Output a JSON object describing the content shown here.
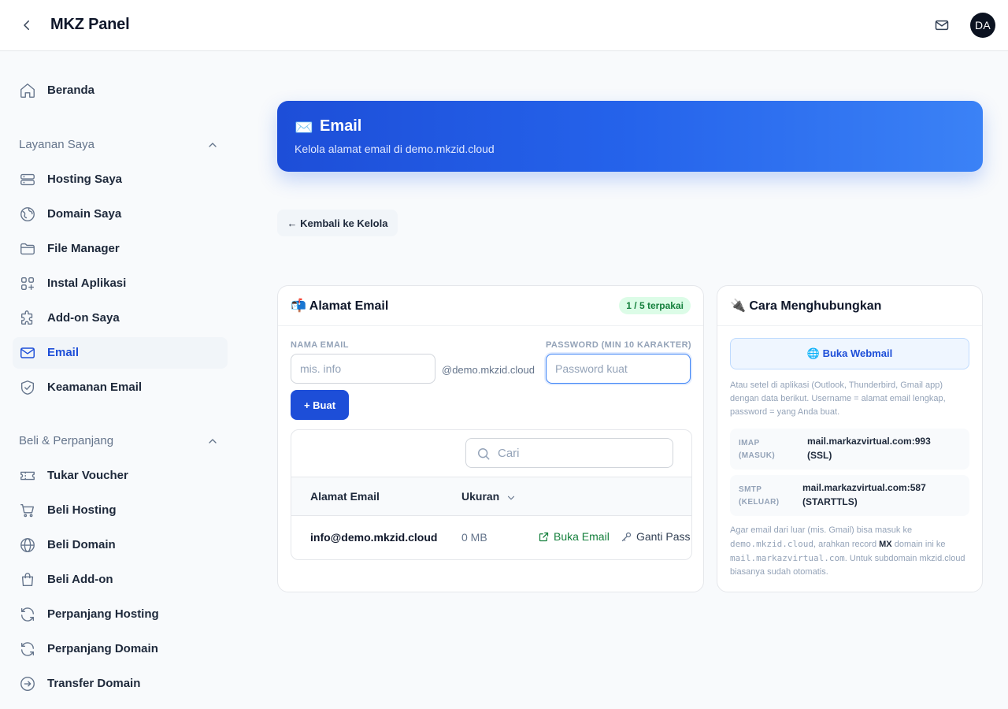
{
  "app": {
    "title": "MKZ Panel",
    "avatar_initials": "DA"
  },
  "icons": {
    "back": "chevron-left-icon",
    "mail": "mail-icon"
  },
  "sidebar": {
    "home": {
      "label": "Beranda",
      "icon": "home-icon"
    },
    "section_services": {
      "label": "Layanan Saya",
      "expanded": true
    },
    "services": [
      {
        "label": "Hosting Saya",
        "icon": "server-icon"
      },
      {
        "label": "Domain Saya",
        "icon": "globe-icon"
      },
      {
        "label": "File Manager",
        "icon": "folder-icon"
      },
      {
        "label": "Instal Aplikasi",
        "icon": "apps-icon"
      },
      {
        "label": "Add-on Saya",
        "icon": "puzzle-icon"
      },
      {
        "label": "Email",
        "icon": "mail-icon",
        "active": true
      },
      {
        "label": "Keamanan Email",
        "icon": "shield-check-icon"
      }
    ],
    "section_buy": {
      "label": "Beli & Perpanjang",
      "expanded": true
    },
    "buy": [
      {
        "label": "Tukar Voucher",
        "icon": "ticket-icon"
      },
      {
        "label": "Beli Hosting",
        "icon": "cart-icon"
      },
      {
        "label": "Beli Domain",
        "icon": "globe-icon"
      },
      {
        "label": "Beli Add-on",
        "icon": "shopping-bag-icon"
      },
      {
        "label": "Perpanjang Hosting",
        "icon": "refresh-icon"
      },
      {
        "label": "Perpanjang Domain",
        "icon": "refresh-icon"
      },
      {
        "label": "Transfer Domain",
        "icon": "arrow-circle-icon"
      }
    ]
  },
  "hero": {
    "icon": "✉️",
    "title": "Email",
    "subtitle": "Kelola alamat email di demo.mkzid.cloud"
  },
  "back_link": "← Kembali ke Kelola",
  "accounts_card": {
    "icon": "📬",
    "title": "Alamat Email",
    "badge": "1 / 5 terpakai",
    "name_label": "NAMA EMAIL",
    "name_placeholder": "mis. info",
    "name_value": "",
    "domain_suffix": "@demo.mkzid.cloud",
    "password_label": "PASSWORD (MIN 10 KARAKTER)",
    "password_placeholder": "Password kuat",
    "password_value": "",
    "create_button": "+ Buat",
    "search_placeholder": "Cari",
    "columns": [
      "Alamat Email",
      "Ukuran"
    ],
    "rows": [
      {
        "email": "info@demo.mkzid.cloud",
        "size": "0 MB",
        "action_open": "Buka Email",
        "action_password": "Ganti Pass"
      }
    ]
  },
  "connect_card": {
    "icon": "🔌",
    "title": "Cara Menghubungkan",
    "webmail_button": "🌐 Buka Webmail",
    "intro": "Atau setel di aplikasi (Outlook, Thunderbird, Gmail app) dengan data berikut. Username = alamat email lengkap, password = yang Anda buat.",
    "imap": {
      "key_1": "IMAP",
      "key_2": "(MASUK)",
      "host": "mail.markazvirtual.com:993",
      "security": "(SSL)"
    },
    "smtp": {
      "key_1": "SMTP",
      "key_2": "(KELUAR)",
      "host": "mail.markazvirtual.com:587",
      "security": "(STARTTLS)"
    },
    "note": {
      "p1": "Agar email dari luar (mis. Gmail) bisa masuk ke",
      "domain": "demo.mkzid.cloud",
      "p2": ", arahkan record",
      "record": "MX",
      "p3": "domain ini ke",
      "host": "mail.markazvirtual.com",
      "p4": ". Untuk subdomain mkzid.cloud biasanya sudah otomatis."
    }
  },
  "colors": {
    "primary": "#1d4ed8",
    "success": "#15803d",
    "badge_bg": "#dcfce7"
  }
}
